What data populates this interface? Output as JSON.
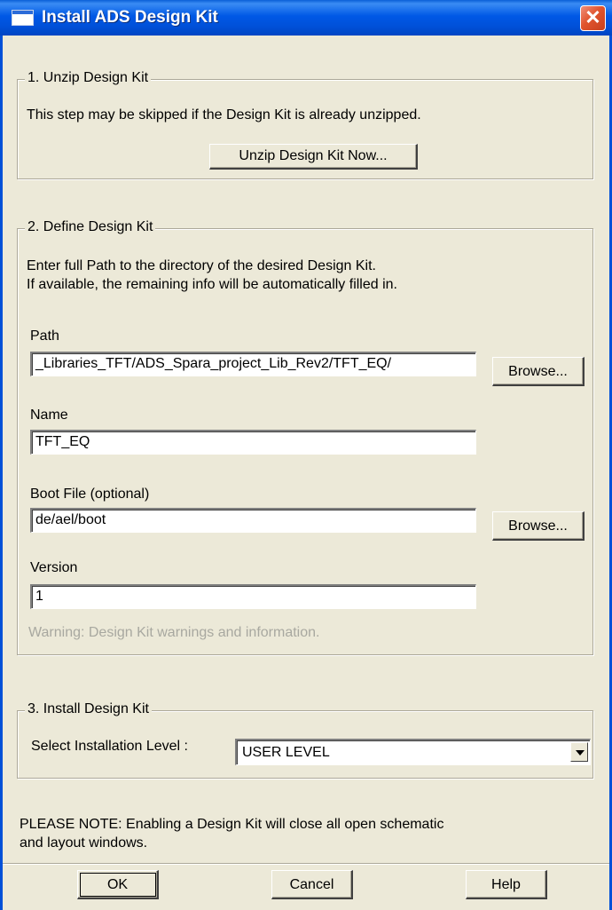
{
  "window": {
    "title": "Install ADS Design Kit",
    "close_glyph": "✕"
  },
  "section1": {
    "legend": "1. Unzip Design Kit",
    "description": "This step may be skipped if the Design Kit is already unzipped.",
    "unzip_button": "Unzip Design Kit Now..."
  },
  "section2": {
    "legend": "2. Define Design Kit",
    "description_line1": "Enter full Path to the directory of the desired Design Kit.",
    "description_line2": "If available, the remaining info will be automatically filled in.",
    "path_label": "Path",
    "path_value": "_Libraries_TFT/ADS_Spara_project_Lib_Rev2/TFT_EQ/",
    "path_browse": "Browse...",
    "name_label": "Name",
    "name_value": "TFT_EQ",
    "boot_label": "Boot File (optional)",
    "boot_value": "de/ael/boot",
    "boot_browse": "Browse...",
    "version_label": "Version",
    "version_value": "1",
    "warning": "Warning: Design Kit warnings and information."
  },
  "section3": {
    "legend": "3. Install Design Kit",
    "level_label": "Select Installation Level :",
    "level_value": "USER LEVEL"
  },
  "note": {
    "line1": "PLEASE NOTE: Enabling a Design Kit will close all open schematic",
    "line2": "and layout windows."
  },
  "footer": {
    "ok": "OK",
    "cancel": "Cancel",
    "help": "Help"
  },
  "colors": {
    "title_bar": "#0058e6",
    "dialog_bg": "#ece9d8",
    "close_button": "#e0542e",
    "warning_text": "#a8a8a0"
  }
}
